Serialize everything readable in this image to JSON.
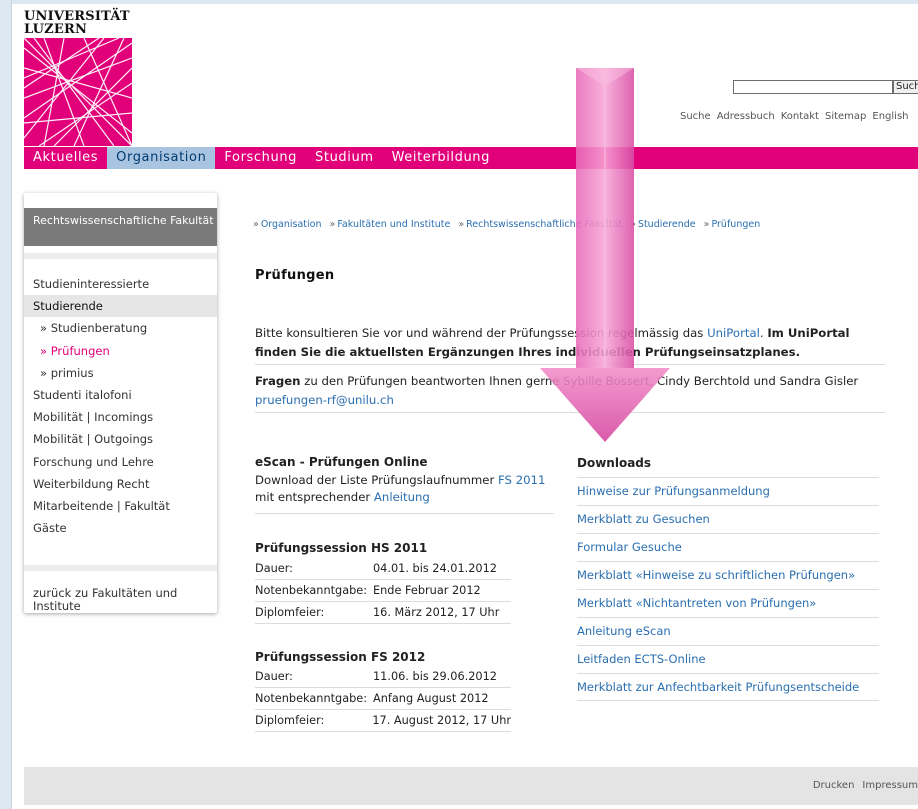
{
  "logo": {
    "line1": "UNIVERSITÄT",
    "line2": "LUZERN"
  },
  "search": {
    "button_label": "Suche"
  },
  "top_links": [
    "Suche",
    "Adressbuch",
    "Kontakt",
    "Sitemap",
    "English"
  ],
  "main_nav": [
    "Aktuelles",
    "Organisation",
    "Forschung",
    "Studium",
    "Weiterbildung"
  ],
  "sidebar": {
    "header": "Rechtswissenschaftliche Fakultät",
    "items": [
      "Studieninteressierte",
      "Studierende",
      "» Studienberatung",
      "» Prüfungen",
      "» primius",
      "Studenti italofoni",
      "Mobilität | Incomings",
      "Mobilität | Outgoings",
      "Forschung und Lehre",
      "Weiterbildung Recht",
      "Mitarbeitende | Fakultät",
      "Gäste"
    ],
    "back_link": "zurück zu Fakultäten und Institute"
  },
  "breadcrumb": [
    "Organisation",
    "Fakultäten und Institute",
    "Rechtswissenschaftliche Fakultät",
    "Studierende",
    "Prüfungen"
  ],
  "breadcrumb_sep": "»",
  "page_title": "Prüfungen",
  "intro": {
    "text1": "Bitte konsultieren Sie vor und während der Prüfungssession regelmässig das ",
    "link": "UniPortal",
    "text2": ". ",
    "bold": "Im UniPortal finden Sie die aktuellsten Ergänzungen Ihres individuellen Prüfungseinsatzplanes."
  },
  "fragen": {
    "bold": "Fragen",
    "text": " zu den Prüfungen beantworten Ihnen gerne Sybille Bossert, Cindy Berchtold und Sandra Gisler",
    "email": "pruefungen-rf@unilu.ch"
  },
  "escan": {
    "title": "eScan - Prüfungen Online",
    "text1": "Download der Liste Prüfungslaufnummer ",
    "link1": "FS 2011",
    "text2": "mit entsprechender ",
    "link2": "Anleitung"
  },
  "sessions": [
    {
      "title": "Prüfungssession HS 2011",
      "rows": [
        {
          "key": "Dauer:",
          "value": "04.01. bis 24.01.2012"
        },
        {
          "key": "Notenbekanntgabe:",
          "value": "Ende Februar 2012"
        },
        {
          "key": "Diplomfeier:",
          "value": "16. März 2012, 17 Uhr"
        }
      ]
    },
    {
      "title": "Prüfungssession FS 2012",
      "rows": [
        {
          "key": "Dauer:",
          "value": "11.06. bis 29.06.2012"
        },
        {
          "key": "Notenbekanntgabe:",
          "value": "Anfang August 2012"
        },
        {
          "key": "Diplomfeier:",
          "value": "17. August 2012, 17 Uhr"
        }
      ]
    }
  ],
  "downloads": {
    "title": "Downloads",
    "items": [
      "Hinweise zur Prüfungsanmeldung",
      "Merkblatt zu Gesuchen",
      "Formular Gesuche",
      "Merkblatt «Hinweise zu schriftlichen Prüfungen»",
      "Merkblatt «Nichtantreten von Prüfungen»",
      "Anleitung eScan",
      "Leitfaden ECTS-Online",
      "Merkblatt zur Anfechtbarkeit Prüfungsentscheide"
    ]
  },
  "footer_links": [
    "Drucken",
    "Impressum"
  ],
  "colors": {
    "brand": "#e2007a",
    "link": "#2a6fb0",
    "nav_active": "#a9c4e0"
  }
}
